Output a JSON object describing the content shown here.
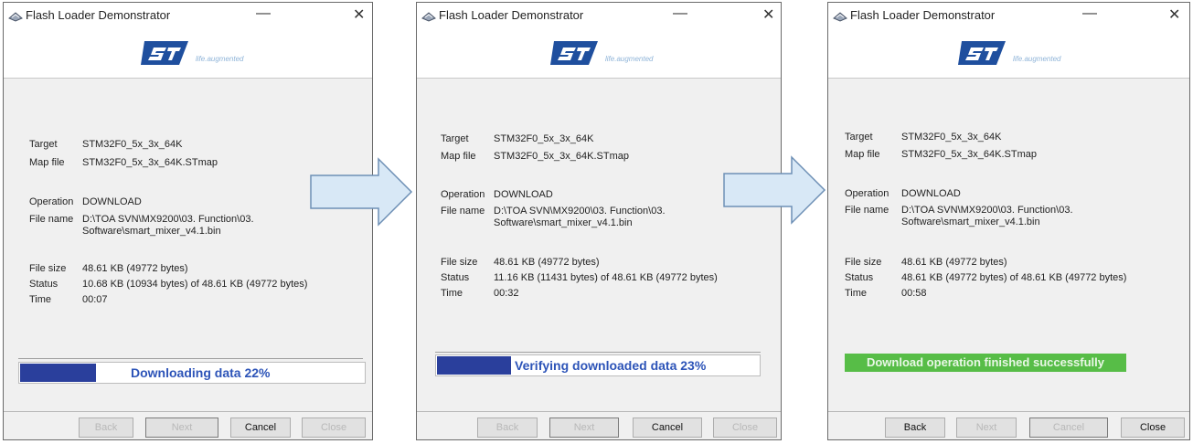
{
  "windows": [
    {
      "title": "Flash Loader Demonstrator",
      "logo_tagline": "life.augmented",
      "labels": {
        "target": "Target",
        "map_file": "Map file",
        "operation": "Operation",
        "file_name": "File name",
        "file_size": "File size",
        "status": "Status",
        "time": "Time"
      },
      "target": "STM32F0_5x_3x_64K",
      "map_file": "STM32F0_5x_3x_64K.STmap",
      "operation": "DOWNLOAD",
      "file_name_line1": "D:\\TOA SVN\\MX9200\\03. Function\\03.",
      "file_name_line2": "Software\\smart_mixer_v4.1.bin",
      "file_size": "48.61 KB (49772 bytes)",
      "status": "10.68 KB (10934 bytes) of 48.61 KB (49772 bytes)",
      "time": "00:07",
      "progress_text": "Downloading data 22%",
      "progress": 0.22,
      "buttons": {
        "back": "Back",
        "next": "Next",
        "cancel": "Cancel",
        "close": "Close"
      }
    },
    {
      "title": "Flash Loader Demonstrator",
      "logo_tagline": "life.augmented",
      "labels": {
        "target": "Target",
        "map_file": "Map file",
        "operation": "Operation",
        "file_name": "File name",
        "file_size": "File size",
        "status": "Status",
        "time": "Time"
      },
      "target": "STM32F0_5x_3x_64K",
      "map_file": "STM32F0_5x_3x_64K.STmap",
      "operation": "DOWNLOAD",
      "file_name_line1": "D:\\TOA SVN\\MX9200\\03. Function\\03.",
      "file_name_line2": "Software\\smart_mixer_v4.1.bin",
      "file_size": "48.61 KB (49772 bytes)",
      "status": "11.16 KB (11431 bytes) of 48.61 KB (49772 bytes)",
      "time": "00:32",
      "progress_text": "Verifying downloaded data 23%",
      "progress": 0.23,
      "buttons": {
        "back": "Back",
        "next": "Next",
        "cancel": "Cancel",
        "close": "Close"
      }
    },
    {
      "title": "Flash Loader Demonstrator",
      "logo_tagline": "life.augmented",
      "labels": {
        "target": "Target",
        "map_file": "Map file",
        "operation": "Operation",
        "file_name": "File name",
        "file_size": "File size",
        "status": "Status",
        "time": "Time"
      },
      "target": "STM32F0_5x_3x_64K",
      "map_file": "STM32F0_5x_3x_64K.STmap",
      "operation": "DOWNLOAD",
      "file_name_line1": "D:\\TOA SVN\\MX9200\\03. Function\\03.",
      "file_name_line2": "Software\\smart_mixer_v4.1.bin",
      "file_size": "48.61 KB (49772 bytes)",
      "status": "48.61 KB (49772 bytes) of 48.61 KB (49772 bytes)",
      "time": "00:58",
      "progress_text": "Download operation finished successfully",
      "progress": 1.0,
      "buttons": {
        "back": "Back",
        "next": "Next",
        "cancel": "Cancel",
        "close": "Close"
      }
    }
  ],
  "colors": {
    "progress_fill": "#2a3f9c",
    "progress_text": "#2d54b8",
    "success_fill": "#57bd47",
    "arrow_fill": "#d8e8f6",
    "arrow_stroke": "#6d8fb5",
    "st_logo": "#1f4f9e"
  },
  "icons": [
    "app-icon",
    "minimize-icon",
    "close-icon",
    "st-logo",
    "right-arrow-icon"
  ]
}
